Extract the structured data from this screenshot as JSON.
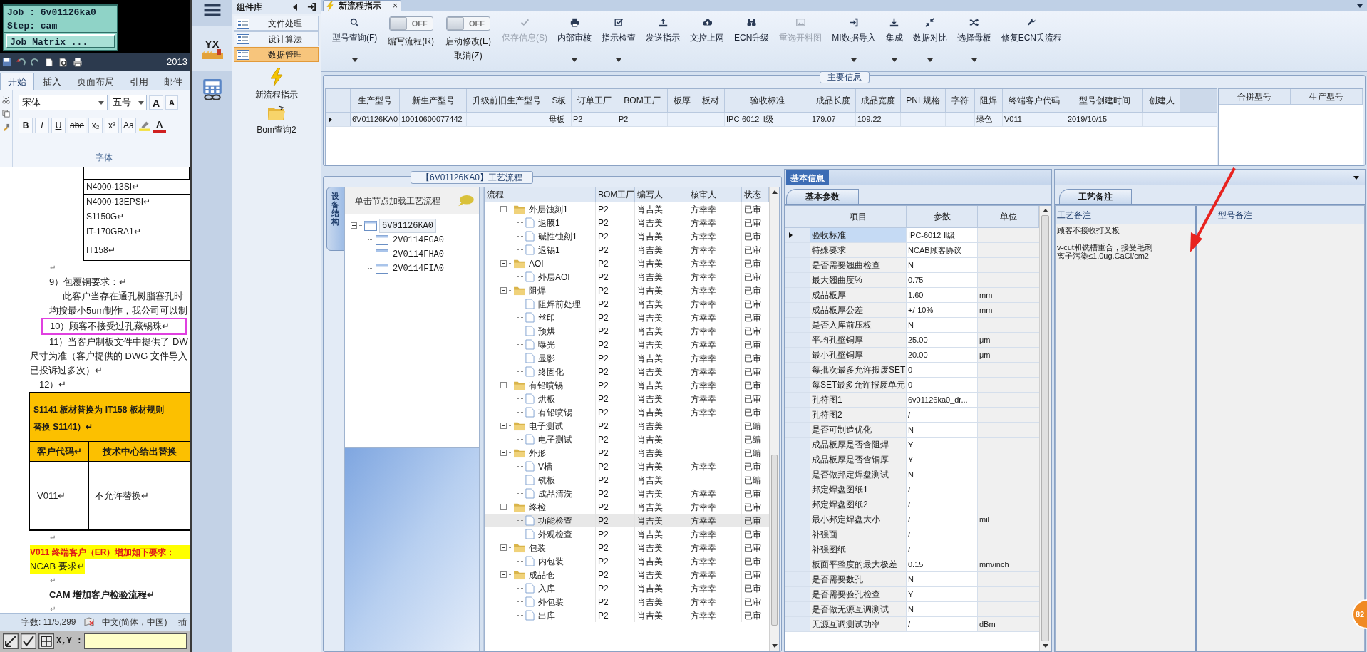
{
  "cam": {
    "job": "Job : 6v01126ka0",
    "step": "Step: cam",
    "matrix_button": "Job Matrix ...",
    "coordinates_label": "X,Y :"
  },
  "word": {
    "title": "2013",
    "ribbon_tabs": [
      {
        "label": "开始",
        "selected": true
      },
      {
        "label": "插入",
        "selected": false
      },
      {
        "label": "页面布局",
        "selected": false
      },
      {
        "label": "引用",
        "selected": false
      },
      {
        "label": "邮件",
        "selected": false
      }
    ],
    "font_name": "宋体",
    "font_size": "五号",
    "grow_font": "A",
    "shrink_font": "A",
    "font_color_button": "A",
    "format_buttons": [
      {
        "kind": "bold",
        "label": "B"
      },
      {
        "kind": "italic",
        "label": "I"
      },
      {
        "kind": "underline",
        "label": "U"
      },
      {
        "kind": "strike",
        "label": "abe"
      },
      {
        "kind": "subscript",
        "label": "x₂"
      },
      {
        "kind": "superscript",
        "label": "x²"
      },
      {
        "kind": "case",
        "label": "Aa"
      }
    ],
    "group_label": "字体",
    "material_table": [
      "N4000-13SI↵",
      "N4000-13EPSI↵",
      "S1150G↵",
      "IT-170GRA1↵",
      "IT158↵"
    ],
    "paragraphs": [
      {
        "kind": "mark",
        "text": "↵"
      },
      {
        "kind": "item",
        "text": "9）包覆铜要求：↵"
      },
      {
        "kind": "indent",
        "text": "此客户当存在通孔树脂塞孔时"
      },
      {
        "kind": "item",
        "text": "均按最小5um制作，我公司可以制"
      },
      {
        "kind": "framed",
        "text": "10）顾客不接受过孔藏锡珠↵"
      },
      {
        "kind": "item",
        "text": "11）当客户制板文件中提供了 DW"
      },
      {
        "kind": "flush",
        "text": "尺寸为准（客户提供的 DWG 文件导入"
      },
      {
        "kind": "flush",
        "text": "已投诉过多次）↵"
      },
      {
        "kind": "sub",
        "text": "12）↵"
      }
    ],
    "replacement_table": {
      "title": "S1141 板材替换为 IT158 板材规则",
      "title_end": "替换 S1141）↵",
      "columns": [
        "客户代码↵",
        "技术中心给出替换"
      ],
      "row": [
        "V011↵",
        "不允许替换↵"
      ]
    },
    "after_table": [
      {
        "kind": "mark",
        "text": "↵"
      },
      {
        "kind": "alert",
        "text": "V011 终端客户（ER）增加如下要求："
      },
      {
        "kind": "highlight",
        "text": "NCAB 要求↵"
      },
      {
        "kind": "mark",
        "text": "↵"
      },
      {
        "kind": "heading",
        "text": "CAM 增加客户检验流程↵"
      },
      {
        "kind": "mark",
        "text": "↵"
      }
    ],
    "status_bar": {
      "word_count": "字数: 11/5,299",
      "language": "中文(简体，中国)",
      "mode": "插"
    }
  },
  "app": {
    "logo_text": "YX",
    "component_title": "组件库",
    "components": [
      {
        "label": "文件处理",
        "selected": false
      },
      {
        "label": "设计算法",
        "selected": false
      },
      {
        "label": "数据管理",
        "selected": true
      }
    ],
    "tools": [
      "新流程指示",
      "Bom查询2"
    ]
  },
  "document_tab": {
    "label": "新流程指示",
    "close": "×"
  },
  "toolbar": [
    {
      "kind": "button",
      "label": "型号查询(F)",
      "dropdown": true,
      "disabled": false
    },
    {
      "kind": "toggle",
      "label": "编写流程(R)",
      "switch_text": "OFF",
      "on": false
    },
    {
      "kind": "toggle",
      "label": "启动修改(E)",
      "sublabel": "取消(Z)",
      "switch_text": "OFF",
      "on": false
    },
    {
      "kind": "button",
      "label": "保存信息(S)",
      "dropdown": false,
      "disabled": true
    },
    {
      "kind": "button",
      "label": "内部审核",
      "dropdown": true,
      "disabled": false
    },
    {
      "kind": "button",
      "label": "指示检查",
      "dropdown": true,
      "disabled": false
    },
    {
      "kind": "button",
      "label": "发送指示",
      "dropdown": false,
      "disabled": false
    },
    {
      "kind": "button",
      "label": "文控上网",
      "dropdown": false,
      "disabled": false
    },
    {
      "kind": "button",
      "label": "ECN升级",
      "dropdown": false,
      "disabled": false
    },
    {
      "kind": "button",
      "label": "重选开料图",
      "dropdown": false,
      "disabled": true
    },
    {
      "kind": "button",
      "label": "MI数据导入",
      "dropdown": true,
      "disabled": false
    },
    {
      "kind": "button",
      "label": "集成",
      "dropdown": true,
      "disabled": false
    },
    {
      "kind": "button",
      "label": "数据对比",
      "dropdown": true,
      "disabled": false
    },
    {
      "kind": "button",
      "label": "选择母板",
      "dropdown": true,
      "disabled": false
    },
    {
      "kind": "button",
      "label": "修复ECN丢流程",
      "dropdown": false,
      "disabled": false
    }
  ],
  "main_info": {
    "title": "主要信息",
    "columns": [
      "生产型号",
      "新生产型号",
      "升级前旧生产型号",
      "S板",
      "订单工厂",
      "BOM工厂",
      "板厚",
      "板材",
      "验收标准",
      "成品长度",
      "成品宽度",
      "PNL规格",
      "字符",
      "阻焊",
      "终端客户代码",
      "型号创建时间",
      "创建人"
    ],
    "rows": [
      {
        "selected": true,
        "cells": [
          "6V01126KA0",
          "10010600077442",
          "",
          "母板",
          "P2",
          "P2",
          "",
          "",
          "IPC-6012 Ⅱ级",
          "179.07",
          "109.22",
          "",
          "",
          "绿色",
          "V011",
          "2019/10/15",
          ""
        ]
      }
    ],
    "side_columns": [
      "合拼型号",
      "生产型号"
    ]
  },
  "process": {
    "title": "【6V01126KA0】工艺流程",
    "side_tab": "设备结构",
    "tree_hint": "单击节点加载工艺流程",
    "tree": {
      "label": "6V01126KA0",
      "expanded": true,
      "selected": true,
      "children": [
        {
          "label": "2V0114FGA0",
          "selected": false
        },
        {
          "label": "2V0114FHA0",
          "selected": false
        },
        {
          "label": "2V0114FIA0",
          "selected": false
        }
      ]
    },
    "columns": [
      "流程",
      "BOM工厂",
      "编写人",
      "核审人",
      "状态"
    ],
    "rows": [
      {
        "label": "外层蚀刻1",
        "bom": "P2",
        "writer": "肖吉美",
        "reviewer": "方幸幸",
        "status": "已审",
        "expanded": true,
        "selected": false,
        "children": [
          {
            "label": "退膜1",
            "bom": "P2",
            "writer": "肖吉美",
            "reviewer": "方幸幸",
            "status": "已审",
            "selected": false
          },
          {
            "label": "碱性蚀刻1",
            "bom": "P2",
            "writer": "肖吉美",
            "reviewer": "方幸幸",
            "status": "已审",
            "selected": false
          },
          {
            "label": "退锡1",
            "bom": "P2",
            "writer": "肖吉美",
            "reviewer": "方幸幸",
            "status": "已审",
            "selected": false
          }
        ]
      },
      {
        "label": "AOI",
        "bom": "P2",
        "writer": "肖吉美",
        "reviewer": "方幸幸",
        "status": "已审",
        "expanded": true,
        "selected": false,
        "children": [
          {
            "label": "外层AOI",
            "bom": "P2",
            "writer": "肖吉美",
            "reviewer": "方幸幸",
            "status": "已审",
            "selected": false
          }
        ]
      },
      {
        "label": "阻焊",
        "bom": "P2",
        "writer": "肖吉美",
        "reviewer": "方幸幸",
        "status": "已审",
        "expanded": true,
        "selected": false,
        "children": [
          {
            "label": "阻焊前处理",
            "bom": "P2",
            "writer": "肖吉美",
            "reviewer": "方幸幸",
            "status": "已审",
            "selected": false
          },
          {
            "label": "丝印",
            "bom": "P2",
            "writer": "肖吉美",
            "reviewer": "方幸幸",
            "status": "已审",
            "selected": false
          },
          {
            "label": "预烘",
            "bom": "P2",
            "writer": "肖吉美",
            "reviewer": "方幸幸",
            "status": "已审",
            "selected": false
          },
          {
            "label": "曝光",
            "bom": "P2",
            "writer": "肖吉美",
            "reviewer": "方幸幸",
            "status": "已审",
            "selected": false
          },
          {
            "label": "显影",
            "bom": "P2",
            "writer": "肖吉美",
            "reviewer": "方幸幸",
            "status": "已审",
            "selected": false
          },
          {
            "label": "终固化",
            "bom": "P2",
            "writer": "肖吉美",
            "reviewer": "方幸幸",
            "status": "已审",
            "selected": false
          }
        ]
      },
      {
        "label": "有铅喷锡",
        "bom": "P2",
        "writer": "肖吉美",
        "reviewer": "方幸幸",
        "status": "已审",
        "expanded": true,
        "selected": false,
        "children": [
          {
            "label": "烘板",
            "bom": "P2",
            "writer": "肖吉美",
            "reviewer": "方幸幸",
            "status": "已审",
            "selected": false
          },
          {
            "label": "有铅喷锡",
            "bom": "P2",
            "writer": "肖吉美",
            "reviewer": "方幸幸",
            "status": "已审",
            "selected": false
          }
        ]
      },
      {
        "label": "电子测试",
        "bom": "P2",
        "writer": "肖吉美",
        "status": "已编",
        "expanded": true,
        "selected": false,
        "children": [
          {
            "label": "电子测试",
            "bom": "P2",
            "writer": "肖吉美",
            "status": "已编",
            "selected": false
          }
        ]
      },
      {
        "label": "外形",
        "bom": "P2",
        "writer": "肖吉美",
        "status": "已编",
        "expanded": true,
        "selected": false,
        "children": [
          {
            "label": "V槽",
            "bom": "P2",
            "writer": "肖吉美",
            "reviewer": "方幸幸",
            "status": "已审",
            "selected": false
          },
          {
            "label": "铣板",
            "bom": "P2",
            "writer": "肖吉美",
            "status": "已编",
            "selected": false
          },
          {
            "label": "成品清洗",
            "bom": "P2",
            "writer": "肖吉美",
            "reviewer": "方幸幸",
            "status": "已审",
            "selected": false
          }
        ]
      },
      {
        "label": "终检",
        "bom": "P2",
        "writer": "肖吉美",
        "reviewer": "方幸幸",
        "status": "已审",
        "expanded": true,
        "selected": false,
        "children": [
          {
            "label": "功能检查",
            "bom": "P2",
            "writer": "肖吉美",
            "reviewer": "方幸幸",
            "status": "已审",
            "selected": true
          },
          {
            "label": "外观检查",
            "bom": "P2",
            "writer": "肖吉美",
            "reviewer": "方幸幸",
            "status": "已审",
            "selected": false
          }
        ]
      },
      {
        "label": "包装",
        "bom": "P2",
        "writer": "肖吉美",
        "reviewer": "方幸幸",
        "status": "已审",
        "expanded": true,
        "selected": false,
        "children": [
          {
            "label": "内包装",
            "bom": "P2",
            "writer": "肖吉美",
            "reviewer": "方幸幸",
            "status": "已审",
            "selected": false
          }
        ]
      },
      {
        "label": "成品仓",
        "bom": "P2",
        "writer": "肖吉美",
        "reviewer": "方幸幸",
        "status": "已审",
        "expanded": true,
        "selected": false,
        "children": [
          {
            "label": "入库",
            "bom": "P2",
            "writer": "肖吉美",
            "reviewer": "方幸幸",
            "status": "已审",
            "selected": false
          },
          {
            "label": "外包装",
            "bom": "P2",
            "writer": "肖吉美",
            "reviewer": "方幸幸",
            "status": "已审",
            "selected": false
          },
          {
            "label": "出库",
            "bom": "P2",
            "writer": "肖吉美",
            "reviewer": "方幸幸",
            "status": "已审",
            "selected": false
          }
        ]
      }
    ]
  },
  "basic_info": {
    "tab": "基本信息",
    "subtab": "基本参数",
    "columns": [
      "项目",
      "参数",
      "单位"
    ],
    "rows": [
      {
        "name": "验收标准",
        "value": "IPC-6012 Ⅱ级",
        "selected": true
      },
      {
        "name": "特殊要求",
        "value": "NCAB顾客协议",
        "selected": false
      },
      {
        "name": "是否需要翘曲检查",
        "value": "N",
        "selected": false
      },
      {
        "name": "最大翘曲度%",
        "value": "0.75",
        "selected": false
      },
      {
        "name": "成品板厚",
        "value": "1.60",
        "unit": "mm",
        "selected": false
      },
      {
        "name": "成品板厚公差",
        "value": "+/-10%",
        "unit": "mm",
        "selected": false
      },
      {
        "name": "是否入库前压板",
        "value": "N",
        "selected": false
      },
      {
        "name": "平均孔壁铜厚",
        "value": "25.00",
        "unit": "μm",
        "selected": false
      },
      {
        "name": "最小孔壁铜厚",
        "value": "20.00",
        "unit": "μm",
        "selected": false
      },
      {
        "name": "每批次最多允许报废SET",
        "value": "0",
        "selected": false
      },
      {
        "name": "每SET最多允许报废单元",
        "value": "0",
        "selected": false
      },
      {
        "name": "孔符图1",
        "value": "6v01126ka0_dr...",
        "selected": false
      },
      {
        "name": "孔符图2",
        "value": "/",
        "selected": false
      },
      {
        "name": "是否可制造优化",
        "value": "N",
        "selected": false
      },
      {
        "name": "成品板厚是否含阻焊",
        "value": "Y",
        "selected": false
      },
      {
        "name": "成品板厚是否含铜厚",
        "value": "Y",
        "selected": false
      },
      {
        "name": "是否做邦定焊盘测试",
        "value": "N",
        "selected": false
      },
      {
        "name": "邦定焊盘图纸1",
        "value": "/",
        "selected": false
      },
      {
        "name": "邦定焊盘图纸2",
        "value": "/",
        "selected": false
      },
      {
        "name": "最小邦定焊盘大小",
        "value": "/",
        "unit": "mil",
        "selected": false
      },
      {
        "name": "补强面",
        "value": "/",
        "selected": false
      },
      {
        "name": "补强图纸",
        "value": "/",
        "selected": false
      },
      {
        "name": "板面平整度的最大极差",
        "value": "0.15",
        "unit": "mm/inch",
        "selected": false
      },
      {
        "name": "是否需要数孔",
        "value": "N",
        "selected": false
      },
      {
        "name": "是否需要验孔检查",
        "value": "Y",
        "selected": false
      },
      {
        "name": "是否做无源互调测试",
        "value": "N",
        "selected": false
      },
      {
        "name": "无源互调测试功率",
        "value": "/",
        "unit": "dBm",
        "selected": false
      }
    ]
  },
  "remarks": {
    "tab": "工艺备注",
    "columns": [
      "工艺备注",
      "型号备注"
    ],
    "paragraphs": [
      [
        "顾客不接收打叉板"
      ],
      [
        "v-cut和铣槽重合，接受毛刺",
        "离子污染≤1.0ug.CaCl/cm2"
      ]
    ]
  },
  "badge": "82"
}
